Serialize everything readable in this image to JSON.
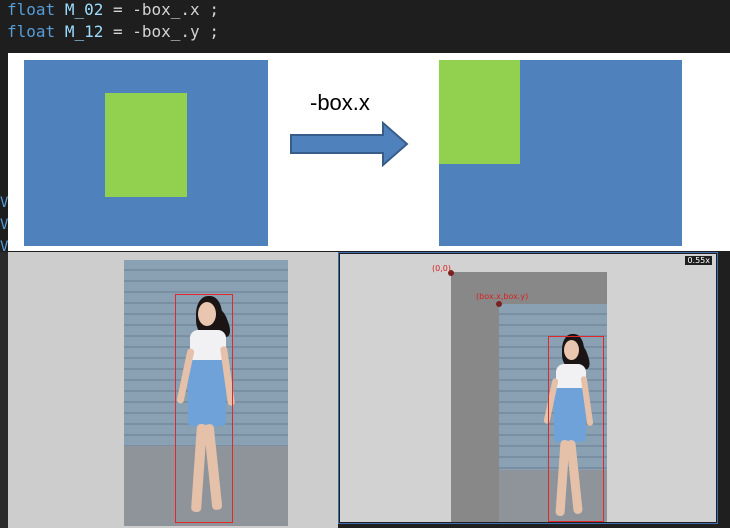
{
  "code": {
    "line1": {
      "type": "float",
      "var": "M_02",
      "op": " = ",
      "expr": "-box_.x ;"
    },
    "line2": {
      "type": "float",
      "var": "M_12",
      "op": " = ",
      "expr": "-box_.y ;"
    }
  },
  "diagram": {
    "arrow_label": "-box.x",
    "colors": {
      "blue": "#4f81bd",
      "green": "#92d050"
    }
  },
  "viewer": {
    "zoom": "0.55x",
    "origin_label": "(0,0)",
    "box_label": "(box.x,box.y)"
  },
  "icons": [
    "right-arrow-icon"
  ]
}
